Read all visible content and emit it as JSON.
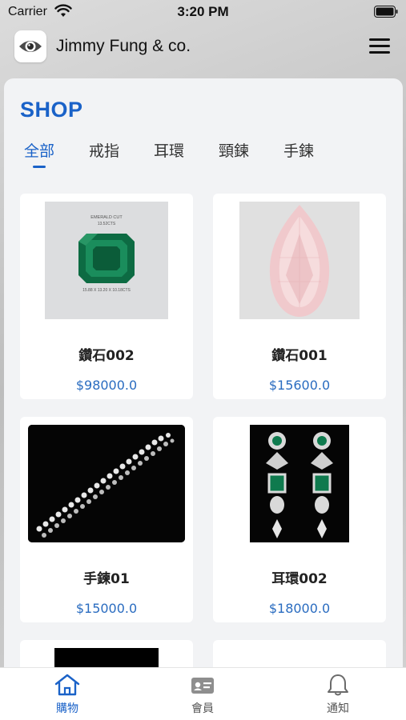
{
  "status_bar": {
    "carrier": "Carrier",
    "time": "3:20 PM"
  },
  "header": {
    "brand": "Jimmy Fung & co."
  },
  "shop": {
    "title": "SHOP",
    "tabs": [
      {
        "label": "全部",
        "active": true
      },
      {
        "label": "戒指",
        "active": false
      },
      {
        "label": "耳環",
        "active": false
      },
      {
        "label": "頸鍊",
        "active": false
      },
      {
        "label": "手鍊",
        "active": false
      }
    ],
    "products": [
      {
        "name": "鑽石002",
        "price": "$98000.0",
        "image_icon": "emerald-gem-image",
        "image_caption_top": "EMERALD CUT",
        "image_caption_weight": "13.52CTS",
        "image_caption_bottom": "15.88 X 13.20 X 10.18CTS"
      },
      {
        "name": "鑽石001",
        "price": "$15600.0",
        "image_icon": "pink-diamond-image"
      },
      {
        "name": "手鍊01",
        "price": "$15000.0",
        "image_icon": "diamond-bracelet-image"
      },
      {
        "name": "耳環002",
        "price": "$18000.0",
        "image_icon": "emerald-earrings-image"
      }
    ]
  },
  "bottom_nav": {
    "items": [
      {
        "label": "購物",
        "icon": "home-icon",
        "active": true
      },
      {
        "label": "會員",
        "icon": "member-card-icon",
        "active": false
      },
      {
        "label": "通知",
        "icon": "bell-icon",
        "active": false
      }
    ]
  },
  "colors": {
    "accent": "#1a62c8",
    "price": "#2a6cc0",
    "emerald": "#0f7a4e",
    "pink_diamond": "#f0c9cc"
  }
}
